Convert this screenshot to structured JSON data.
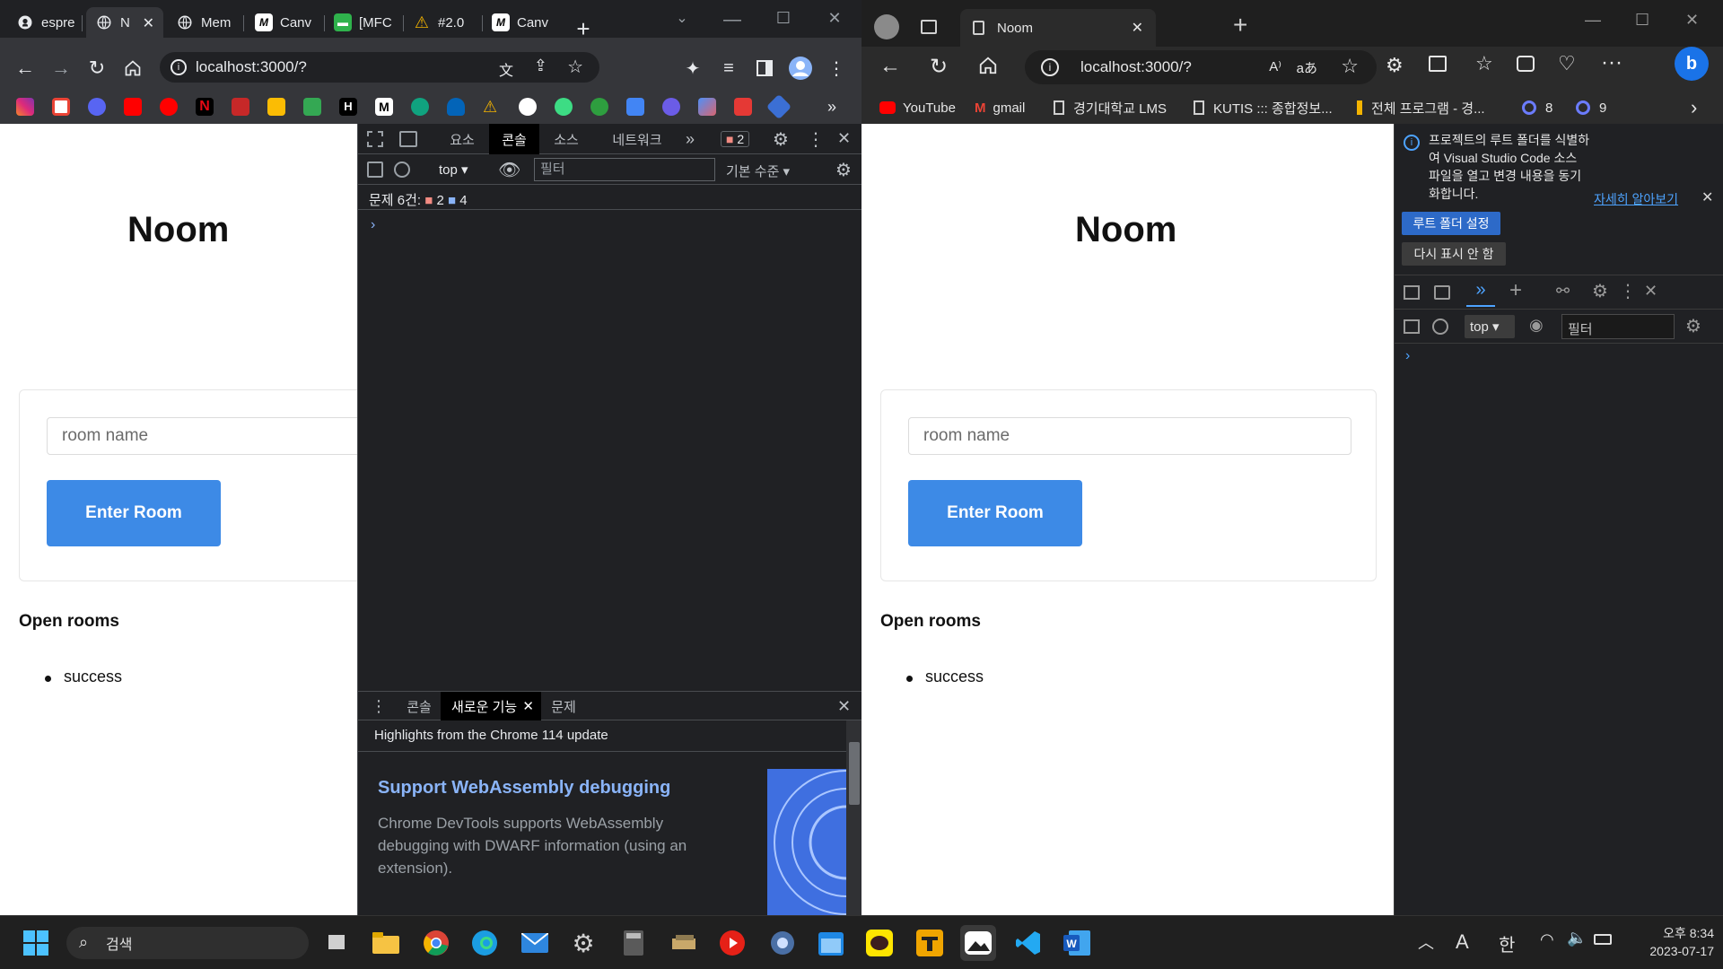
{
  "chrome": {
    "tabs": [
      {
        "label": "espre",
        "icon": "github-icon",
        "active": false
      },
      {
        "label": "N",
        "icon": "globe-icon",
        "active": true
      },
      {
        "label": "Mem",
        "icon": "globe-icon",
        "active": false
      },
      {
        "label": "Canv",
        "icon": "m-logo-icon",
        "active": false
      },
      {
        "label": "[MFC",
        "icon": "chat-icon",
        "active": false
      },
      {
        "label": "#2.0",
        "icon": "warning-icon",
        "active": false
      },
      {
        "label": "Canv",
        "icon": "m-logo-icon",
        "active": false
      }
    ],
    "url": "localhost:3000/?",
    "bookmark_icons": [
      "instagram",
      "gmail",
      "discord",
      "youtube",
      "youtube-music",
      "netflix",
      "radar",
      "maps",
      "sheets",
      "hackers",
      "medium",
      "chatgpt",
      "onedrive",
      "warning",
      "github",
      "m-app",
      "coffee",
      "tasks",
      "info",
      "gemini",
      "notion",
      "vpn"
    ],
    "devtools": {
      "tabs": [
        "요소",
        "콘솔",
        "소스",
        "네트워크"
      ],
      "active_tab": "콘솔",
      "error_badge": "2",
      "context": "top",
      "filter_placeholder": "필터",
      "level": "기본 수준",
      "issues_label": "문제 6건:",
      "issues_errors": "2",
      "issues_info": "4",
      "drawer_tabs": [
        "콘솔",
        "새로운 기능",
        "문제"
      ],
      "drawer_active": "새로운 기능",
      "highlight_text": "Highlights from the Chrome 114 update",
      "feature_title": "Support WebAssembly debugging",
      "feature_desc": "Chrome DevTools supports WebAssembly debugging with DWARF information (using an extension)."
    }
  },
  "page": {
    "title": "Noom",
    "input_placeholder": "room name",
    "button_label": "Enter Room",
    "open_rooms_heading": "Open rooms",
    "rooms": [
      "success"
    ]
  },
  "edge": {
    "tab_title": "Noom",
    "url": "localhost:3000/?",
    "bookmarks": [
      {
        "label": "YouTube",
        "icon": "youtube-icon"
      },
      {
        "label": "gmail",
        "icon": "gmail-icon"
      },
      {
        "label": "경기대학교 LMS",
        "icon": "page-icon"
      },
      {
        "label": "KUTIS ::: 종합정보...",
        "icon": "page-icon"
      },
      {
        "label": "전체 프로그램 - 경...",
        "icon": "bookmark-icon"
      },
      {
        "label": "8",
        "icon": "q-icon"
      },
      {
        "label": "9",
        "icon": "q-icon"
      }
    ],
    "devtools": {
      "info_text": "프로젝트의 루트 폴더를 식별하여 Visual Studio Code 소스 파일을 열고 변경 내용을 동기화합니다.",
      "learn_more": "자세히 알아보기",
      "set_root_button": "루트 폴더 설정",
      "dont_show_button": "다시 표시 안 함",
      "context": "top",
      "filter_placeholder": "필터"
    }
  },
  "taskbar": {
    "search_label": "검색",
    "ime_a": "A",
    "ime_han": "한",
    "time": "오후 8:34",
    "date": "2023-07-17"
  },
  "colors": {
    "accent_button": "#3d8ae6",
    "chrome_dark": "#35363a",
    "devtools_bg": "#202124"
  }
}
